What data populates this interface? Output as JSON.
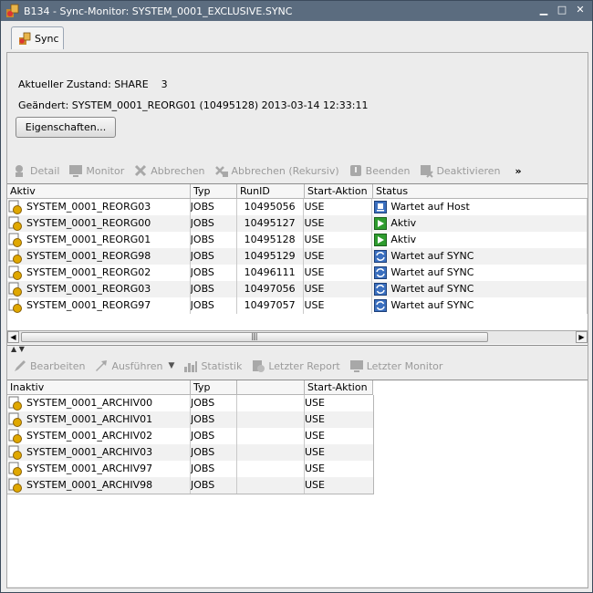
{
  "window": {
    "title": "B134 - Sync-Monitor: SYSTEM_0001_EXCLUSIVE.SYNC",
    "controls": [
      "minimize-icon",
      "maximize-icon",
      "close-icon"
    ]
  },
  "tab": {
    "label": "Sync"
  },
  "info": {
    "state_label": "Aktueller Zustand: SHARE",
    "state_count": "3",
    "changed": "Geändert: SYSTEM_0001_REORG01 (10495128) 2013-03-14 12:33:11"
  },
  "properties_button": "Eigenschaften...",
  "top_toolbar": {
    "detail": "Detail",
    "monitor": "Monitor",
    "abort": "Abbrechen",
    "abort_recursive": "Abbrechen (Rekursiv)",
    "end": "Beenden",
    "deactivate": "Deaktivieren",
    "more": "»"
  },
  "active_table": {
    "headers": [
      "Aktiv",
      "Typ",
      "RunID",
      "Start-Aktion",
      "Status"
    ],
    "rows": [
      {
        "name": "SYSTEM_0001_REORG03",
        "typ": "JOBS",
        "runid": "10495056",
        "start": "USE",
        "status": "Wartet auf Host",
        "status_icon": "host-wait-icon"
      },
      {
        "name": "SYSTEM_0001_REORG00",
        "typ": "JOBS",
        "runid": "10495127",
        "start": "USE",
        "status": "Aktiv",
        "status_icon": "play-icon"
      },
      {
        "name": "SYSTEM_0001_REORG01",
        "typ": "JOBS",
        "runid": "10495128",
        "start": "USE",
        "status": "Aktiv",
        "status_icon": "play-icon"
      },
      {
        "name": "SYSTEM_0001_REORG98",
        "typ": "JOBS",
        "runid": "10495129",
        "start": "USE",
        "status": "Wartet auf SYNC",
        "status_icon": "sync-wait-icon"
      },
      {
        "name": "SYSTEM_0001_REORG02",
        "typ": "JOBS",
        "runid": "10496111",
        "start": "USE",
        "status": "Wartet auf SYNC",
        "status_icon": "sync-wait-icon"
      },
      {
        "name": "SYSTEM_0001_REORG03",
        "typ": "JOBS",
        "runid": "10497056",
        "start": "USE",
        "status": "Wartet auf SYNC",
        "status_icon": "sync-wait-icon"
      },
      {
        "name": "SYSTEM_0001_REORG97",
        "typ": "JOBS",
        "runid": "10497057",
        "start": "USE",
        "status": "Wartet auf SYNC",
        "status_icon": "sync-wait-icon"
      }
    ]
  },
  "bottom_toolbar": {
    "edit": "Bearbeiten",
    "execute": "Ausführen",
    "statistics": "Statistik",
    "last_report": "Letzter Report",
    "last_monitor": "Letzter Monitor"
  },
  "inactive_table": {
    "headers": [
      "Inaktiv",
      "Typ",
      "",
      "Start-Aktion"
    ],
    "rows": [
      {
        "name": "SYSTEM_0001_ARCHIV00",
        "typ": "JOBS",
        "start": "USE"
      },
      {
        "name": "SYSTEM_0001_ARCHIV01",
        "typ": "JOBS",
        "start": "USE"
      },
      {
        "name": "SYSTEM_0001_ARCHIV02",
        "typ": "JOBS",
        "start": "USE"
      },
      {
        "name": "SYSTEM_0001_ARCHIV03",
        "typ": "JOBS",
        "start": "USE"
      },
      {
        "name": "SYSTEM_0001_ARCHIV97",
        "typ": "JOBS",
        "start": "USE"
      },
      {
        "name": "SYSTEM_0001_ARCHIV98",
        "typ": "JOBS",
        "start": "USE"
      }
    ]
  },
  "colors": {
    "titlebar": "#5b6c7f",
    "status_play": "#2e9c2e",
    "status_sync": "#3a6fbf"
  }
}
